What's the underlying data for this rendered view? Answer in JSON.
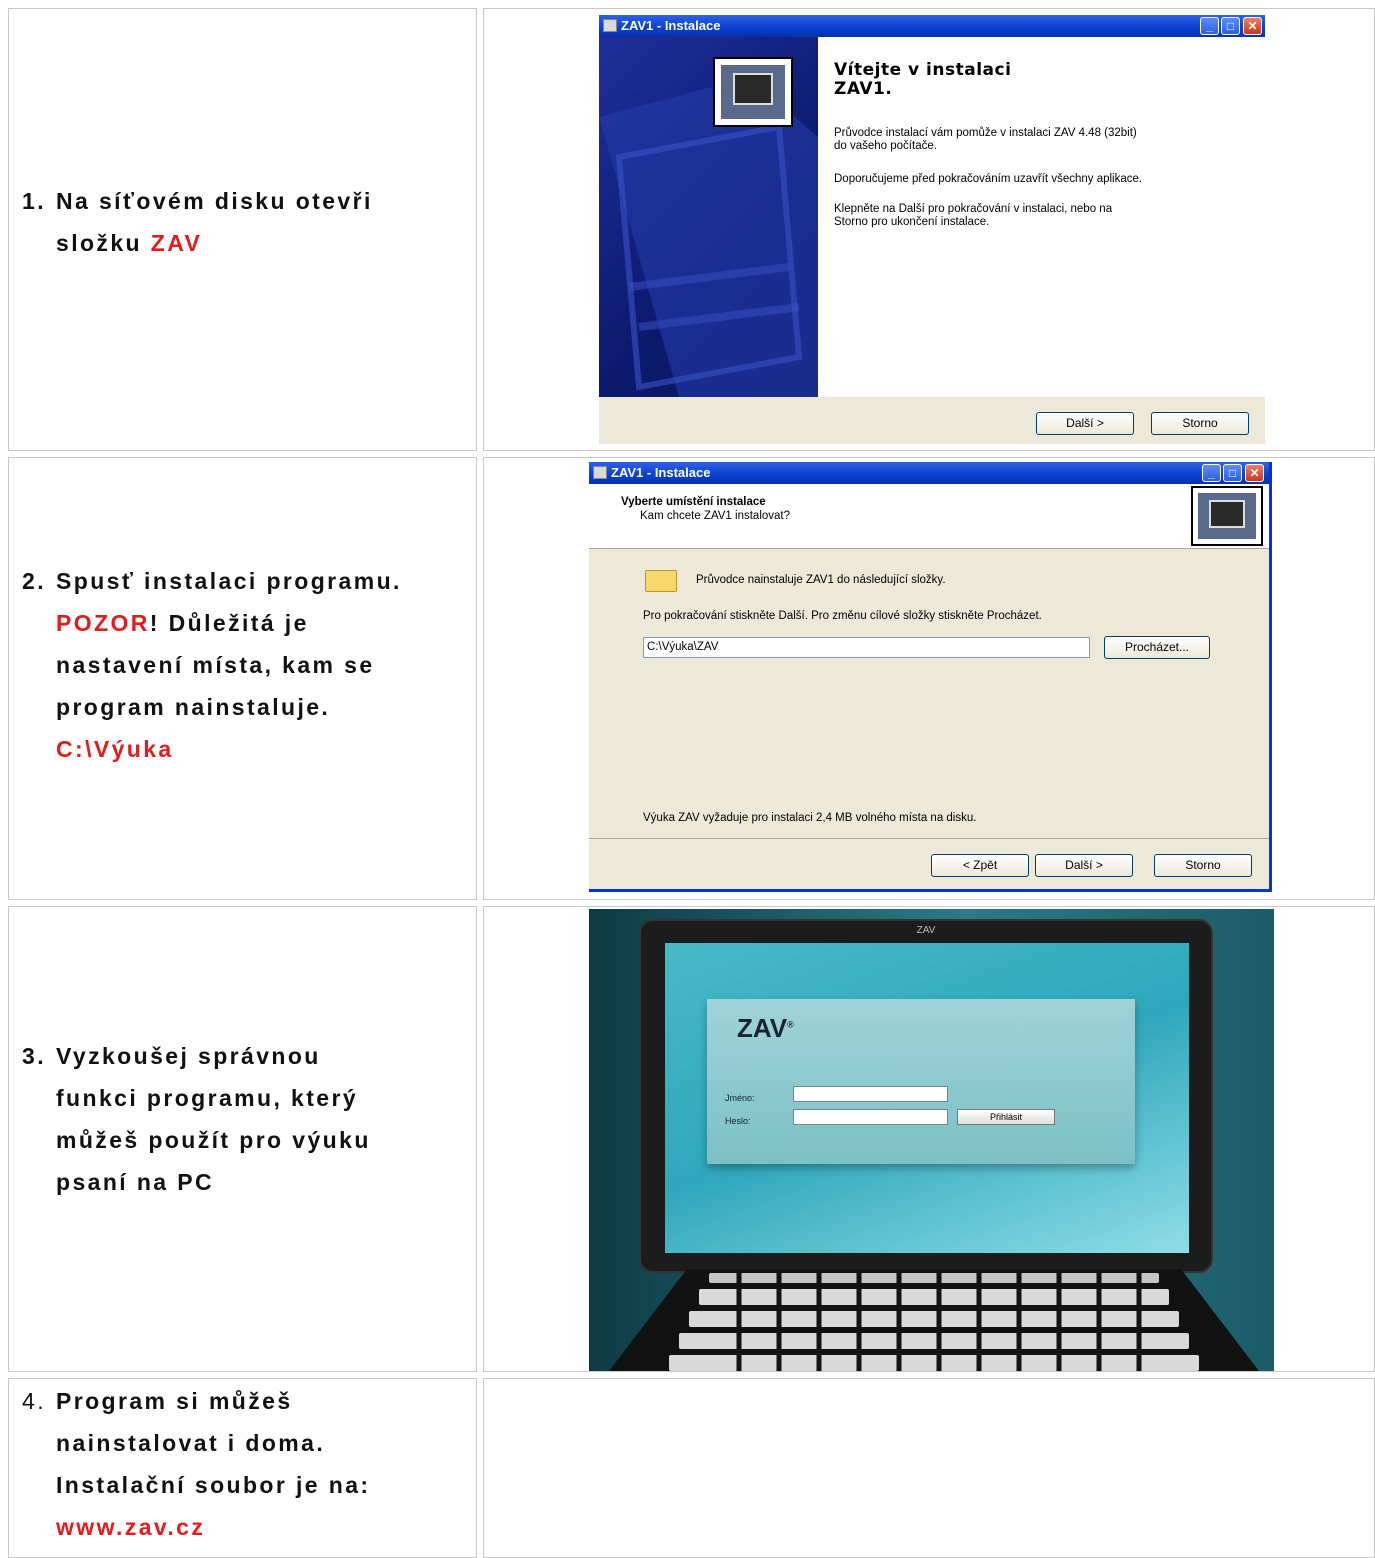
{
  "steps": [
    {
      "num": "1.",
      "lines": [
        "Na síťovém disku otevři",
        "složku "
      ],
      "red": "ZAV"
    },
    {
      "num": "2.",
      "line1": "Spusť instalaci programu.",
      "red1": "POZOR",
      "line2rest": "! Důležitá je",
      "line3": "nastavení místa, kam se",
      "line4": "program nainstaluje.",
      "red2": "C:\\Výuka"
    },
    {
      "num": "3.",
      "lines": [
        "Vyzkoušej správnou",
        "funkci programu, který",
        "můžeš použít pro výuku",
        "psaní na PC"
      ]
    },
    {
      "num": "4.",
      "lines": [
        "Program si můžeš",
        "nainstalovat i doma.",
        "Instalační soubor je na:"
      ],
      "red": "www.zav.cz"
    }
  ],
  "dialog1": {
    "title": "ZAV1 - Instalace",
    "heading": "Vítejte v instalaci ZAV1.",
    "heading_l1": "Vítejte v instalaci",
    "heading_l2": "ZAV1.",
    "p1a": "Průvodce instalací vám pomůže v instalaci ZAV 4.48 (32bit)",
    "p1b": "do vašeho počítače.",
    "p2": "Doporučujeme před pokračováním uzavřít všechny aplikace.",
    "p3a": "Klepněte na Další pro pokračování v instalaci, nebo na",
    "p3b": "Storno pro ukončení instalace.",
    "next": "Další >",
    "cancel": "Storno"
  },
  "dialog2": {
    "title": "ZAV1 - Instalace",
    "heading": "Vyberte umístění instalace",
    "subheading": "Kam chcete ZAV1 instalovat?",
    "info": "Průvodce nainstaluje ZAV1 do následující složky.",
    "instr": "Pro pokračování stiskněte Další. Pro změnu cílové složky stiskněte Procházet.",
    "path": "C:\\Výuka\\ZAV",
    "browse": "Procházet...",
    "space": "Výuka ZAV vyžaduje pro instalaci 2,4 MB volného místa na disku.",
    "back": "< Zpět",
    "next": "Další >",
    "cancel": "Storno"
  },
  "login": {
    "screen_title": "ZAV",
    "logo": "ZAV",
    "reg": "®",
    "name_label": "Jméno:",
    "pass_label": "Heslo:",
    "submit": "Přihlásit"
  },
  "colors": {
    "accent_red": "#e51b1b",
    "xp_blue": "#0a3fd0",
    "xp_face": "#ece9d8"
  }
}
